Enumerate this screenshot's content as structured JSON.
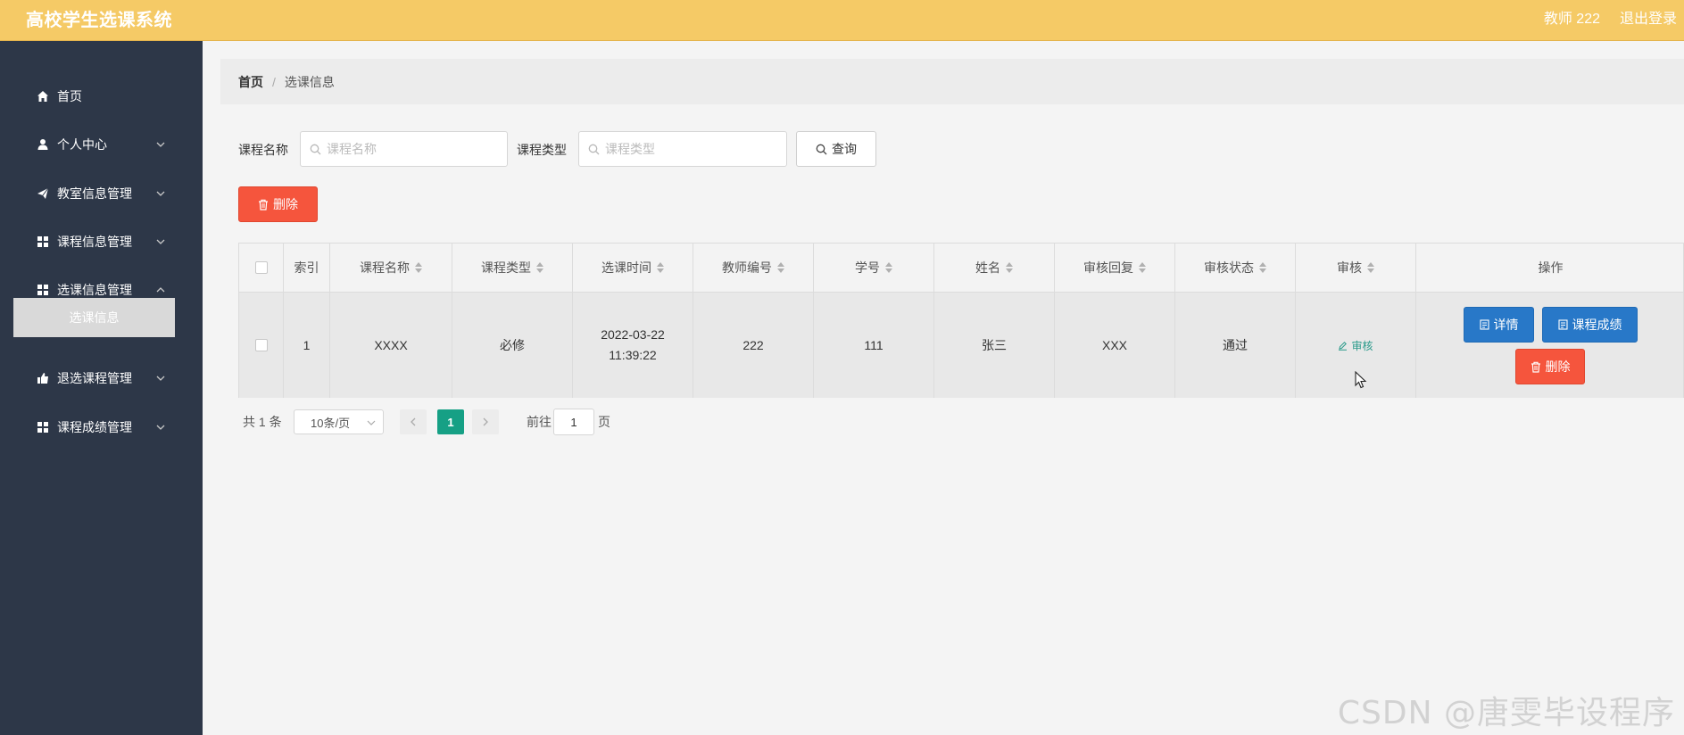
{
  "header": {
    "app_title": "高校学生选课系统",
    "user_label": "教师 222",
    "logout_label": "退出登录"
  },
  "sidebar": {
    "items": [
      {
        "label": "首页",
        "icon": "home-icon"
      },
      {
        "label": "个人中心",
        "icon": "user-icon"
      },
      {
        "label": "教室信息管理",
        "icon": "send-icon"
      },
      {
        "label": "课程信息管理",
        "icon": "grid-icon"
      },
      {
        "label": "选课信息管理",
        "icon": "grid-icon"
      },
      {
        "label": "退选课程管理",
        "icon": "thumb-icon"
      },
      {
        "label": "课程成绩管理",
        "icon": "grid-icon"
      }
    ],
    "active_sub": "选课信息"
  },
  "breadcrumb": {
    "home": "首页",
    "separator": "/",
    "current": "选课信息"
  },
  "search": {
    "course_name_label": "课程名称",
    "course_name_placeholder": "课程名称",
    "course_type_label": "课程类型",
    "course_type_placeholder": "课程类型",
    "query_label": "查询"
  },
  "toolbar": {
    "delete_label": "删除"
  },
  "table": {
    "headers": [
      "索引",
      "课程名称",
      "课程类型",
      "选课时间",
      "教师编号",
      "学号",
      "姓名",
      "审核回复",
      "审核状态",
      "审核",
      "操作"
    ],
    "rows": [
      {
        "index": "1",
        "course_name": "XXXX",
        "course_type": "必修",
        "select_time": "2022-03-22 11:39:22",
        "teacher_no": "222",
        "student_no": "111",
        "name": "张三",
        "reply": "XXX",
        "status": "通过",
        "audit_label": "审核",
        "detail_label": "详情",
        "score_label": "课程成绩",
        "delete_label": "删除"
      }
    ]
  },
  "pagination": {
    "total": "共 1 条",
    "page_size": "10条/页",
    "current_page": "1",
    "goto_label": "前往",
    "goto_value": "1",
    "page_suffix": "页"
  },
  "watermark": "CSDN @唐雯毕设程序",
  "colors": {
    "header": "#f5ca66",
    "sidebar": "#2d3748",
    "danger": "#f5553d",
    "primary": "#2878c8",
    "pager_active": "#16a085"
  }
}
